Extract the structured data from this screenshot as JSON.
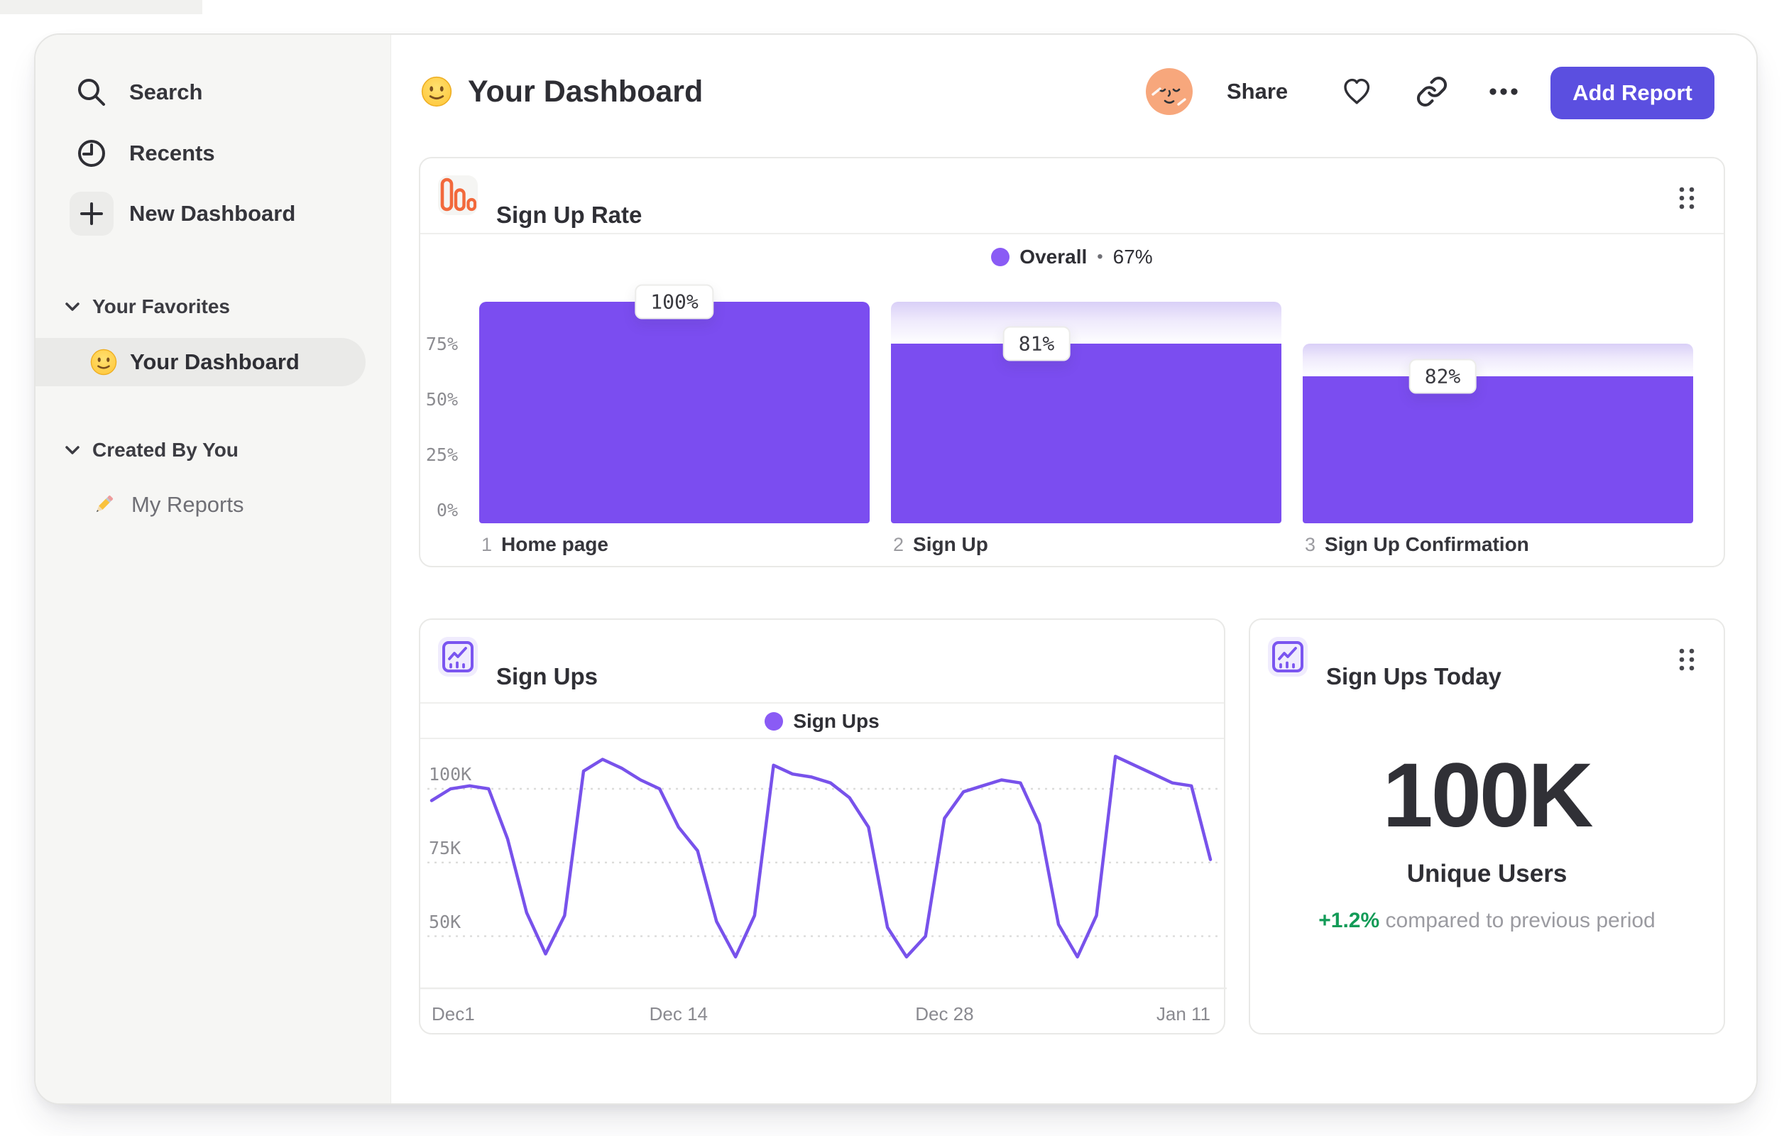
{
  "header": {
    "title": "Your Dashboard",
    "share_label": "Share",
    "add_report_label": "Add Report"
  },
  "sidebar": {
    "nav": [
      {
        "id": "search",
        "label": "Search"
      },
      {
        "id": "recents",
        "label": "Recents"
      },
      {
        "id": "new-dashboard",
        "label": "New Dashboard"
      }
    ],
    "sections": [
      {
        "title": "Your Favorites",
        "items": [
          {
            "label": "Your Dashboard",
            "icon": "smiley-emoji",
            "selected": true
          }
        ]
      },
      {
        "title": "Created By You",
        "items": [
          {
            "label": "My Reports",
            "icon": "pencil-emoji",
            "selected": false
          }
        ]
      }
    ]
  },
  "colors": {
    "bar_purple": "#7B4DF0",
    "legend_purple": "#8A5BF5",
    "line_purple": "#7852EB",
    "button_purple": "#5B4FE0",
    "funnel_icon_orange": "#F2693C",
    "line_icon_purple": "#7A55F0",
    "positive_green": "#129B57",
    "axis_gray": "#8c8c91"
  },
  "chart_data": [
    {
      "id": "signup-rate-funnel",
      "type": "bar",
      "title": "Sign Up Rate",
      "legend": {
        "series": "Overall",
        "value": "67%"
      },
      "categories": [
        "Home page",
        "Sign Up",
        "Sign Up Confirmation"
      ],
      "steps": [
        {
          "num": "1",
          "name": "Home page",
          "conversion_label": "100%",
          "display_height_pct": 100
        },
        {
          "num": "2",
          "name": "Sign Up",
          "conversion_label": "81%",
          "display_height_pct": 81
        },
        {
          "num": "3",
          "name": "Sign Up Confirmation",
          "conversion_label": "82%",
          "display_height_pct": 66.4
        }
      ],
      "yticks": [
        {
          "label": "75%",
          "v": 75
        },
        {
          "label": "50%",
          "v": 50
        },
        {
          "label": "25%",
          "v": 25
        },
        {
          "label": "0%",
          "v": 0
        }
      ],
      "ylim": [
        0,
        100
      ],
      "grid": false,
      "legend_position": "top-center"
    },
    {
      "id": "signups-line",
      "type": "line",
      "title": "Sign Ups",
      "legend": {
        "series": "Sign Ups"
      },
      "xticks": [
        {
          "label": "Dec1",
          "day": 0
        },
        {
          "label": "Dec 14",
          "day": 13
        },
        {
          "label": "Dec 28",
          "day": 27
        },
        {
          "label": "Jan 11",
          "day": 41
        }
      ],
      "yticks": [
        {
          "label": "100K",
          "v": 100
        },
        {
          "label": "75K",
          "v": 75
        },
        {
          "label": "50K",
          "v": 50
        }
      ],
      "y_unit": "K",
      "grid": "dashed-horizontal",
      "legend_position": "top-center",
      "series": [
        {
          "name": "Sign Ups",
          "points_day_valueK": [
            [
              0,
              96
            ],
            [
              1,
              100
            ],
            [
              2,
              101
            ],
            [
              3,
              100
            ],
            [
              4,
              83
            ],
            [
              5,
              58
            ],
            [
              6,
              44
            ],
            [
              7,
              57
            ],
            [
              8,
              106
            ],
            [
              9,
              110
            ],
            [
              10,
              107
            ],
            [
              11,
              103
            ],
            [
              12,
              100
            ],
            [
              13,
              87
            ],
            [
              14,
              79
            ],
            [
              15,
              55
            ],
            [
              16,
              43
            ],
            [
              17,
              57
            ],
            [
              18,
              108
            ],
            [
              19,
              105
            ],
            [
              20,
              104
            ],
            [
              21,
              102
            ],
            [
              22,
              97
            ],
            [
              23,
              87
            ],
            [
              24,
              53
            ],
            [
              25,
              43
            ],
            [
              26,
              50
            ],
            [
              27,
              90
            ],
            [
              28,
              99
            ],
            [
              29,
              101
            ],
            [
              30,
              103
            ],
            [
              31,
              102
            ],
            [
              32,
              88
            ],
            [
              33,
              54
            ],
            [
              34,
              43
            ],
            [
              35,
              57
            ],
            [
              36,
              111
            ],
            [
              37,
              108
            ],
            [
              38,
              105
            ],
            [
              39,
              102
            ],
            [
              40,
              101
            ],
            [
              41,
              76
            ]
          ]
        }
      ]
    },
    {
      "id": "signups-today-metric",
      "type": "metric",
      "title": "Sign Ups Today",
      "value": "100K",
      "value_label": "Unique Users",
      "delta": "+1.2%",
      "delta_description": "compared to previous period"
    }
  ]
}
